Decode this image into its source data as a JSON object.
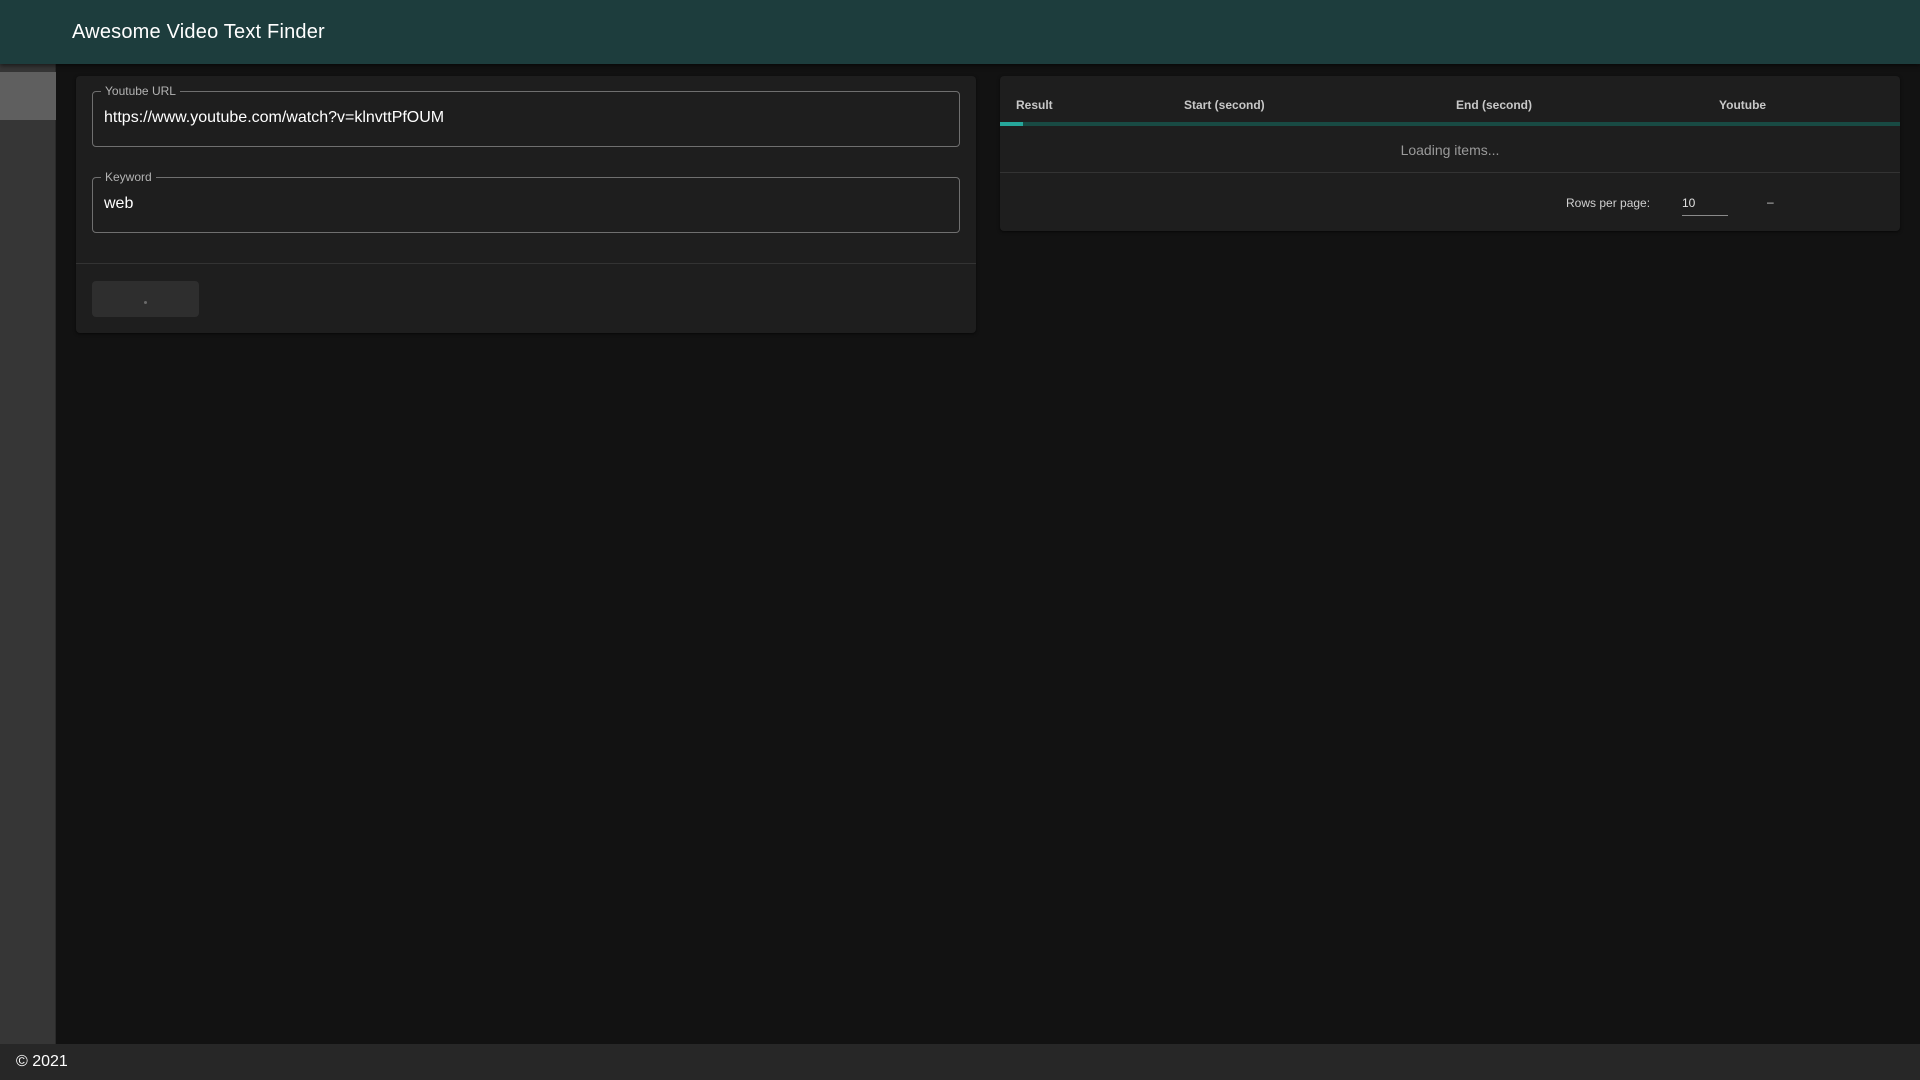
{
  "header": {
    "title": "Awesome Video Text Finder"
  },
  "form": {
    "url": {
      "label": "Youtube URL",
      "value": "https://www.youtube.com/watch?v=klnvttPfOUM"
    },
    "keyword": {
      "label": "Keyword",
      "value": "web"
    },
    "submit_label": ""
  },
  "table": {
    "columns": [
      "Result",
      "Start (second)",
      "End (second)",
      "Youtube"
    ],
    "loading_text": "Loading items...",
    "loading_progress": 0.025,
    "rows_per_page_label": "Rows per page:",
    "rows_per_page_value": "10",
    "page_range": "–"
  },
  "footer": {
    "text": "© 2021"
  },
  "colors": {
    "app_bar": "#1d3d3d",
    "accent": "#26a69a",
    "background": "#121212"
  }
}
